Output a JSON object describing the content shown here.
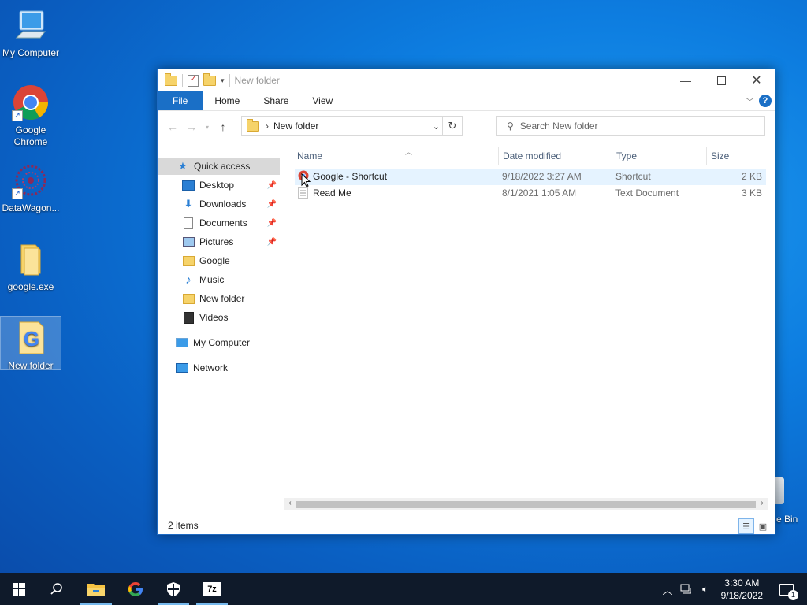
{
  "desktop": {
    "icons": [
      {
        "label": "My Computer"
      },
      {
        "label": "Google Chrome"
      },
      {
        "label": "DataWagon..."
      },
      {
        "label": "google.exe"
      },
      {
        "label": "New folder"
      }
    ],
    "recycle_partial_label": "e Bin"
  },
  "window": {
    "title": "New folder",
    "ribbon_tabs": [
      "File",
      "Home",
      "Share",
      "View"
    ],
    "address_crumb": "New folder",
    "search_placeholder": "Search New folder",
    "nav": {
      "quick_access": "Quick access",
      "pinned": [
        {
          "label": "Desktop"
        },
        {
          "label": "Downloads"
        },
        {
          "label": "Documents"
        },
        {
          "label": "Pictures"
        }
      ],
      "recent": [
        {
          "label": "Google"
        },
        {
          "label": "Music"
        },
        {
          "label": "New folder"
        },
        {
          "label": "Videos"
        }
      ],
      "my_computer": "My Computer",
      "network": "Network"
    },
    "columns": {
      "name": "Name",
      "date": "Date modified",
      "type": "Type",
      "size": "Size"
    },
    "files": [
      {
        "name": "Google - Shortcut",
        "date": "9/18/2022 3:27 AM",
        "type": "Shortcut",
        "size": "2 KB"
      },
      {
        "name": "Read Me",
        "date": "8/1/2021 1:05 AM",
        "type": "Text Document",
        "size": "3 KB"
      }
    ],
    "status": "2 items"
  },
  "taskbar": {
    "time": "3:30 AM",
    "date": "9/18/2022",
    "notification_count": "1"
  },
  "colors": {
    "accent": "#1a6fc6",
    "selection": "#e5f3ff",
    "taskbar": "#0f1a2a"
  }
}
